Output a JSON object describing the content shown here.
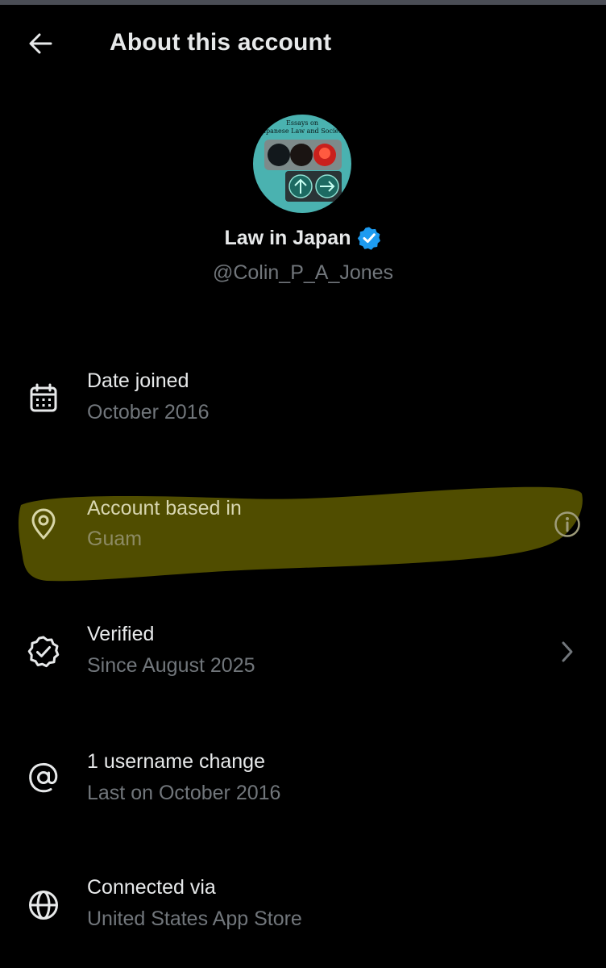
{
  "header": {
    "back_icon": "arrow-left-icon",
    "title": "About this account"
  },
  "profile": {
    "avatar_lines": [
      "Essays on",
      "Japanese Law and Society"
    ],
    "display_name": "Law in Japan",
    "verified_icon": "verified-badge-icon",
    "handle": "@Colin_P_A_Jones"
  },
  "colors": {
    "background": "#000000",
    "primary_text": "#e7e9ea",
    "secondary_text": "#71767b",
    "verified_blue": "#1d9bf0",
    "highlight": "#5a5700"
  },
  "rows": [
    {
      "icon": "calendar-icon",
      "title": "Date joined",
      "subtitle": "October 2016"
    },
    {
      "icon": "location-pin-icon",
      "title": "Account based in",
      "subtitle": "Guam",
      "trailing_icon": "info-icon",
      "highlighted": true
    },
    {
      "icon": "verified-check-icon",
      "title": "Verified",
      "subtitle": "Since August 2025",
      "trailing_icon": "chevron-right-icon"
    },
    {
      "icon": "at-sign-icon",
      "title": "1 username change",
      "subtitle": "Last on October 2016"
    },
    {
      "icon": "globe-icon",
      "title": "Connected via",
      "subtitle": "United States App Store"
    }
  ]
}
